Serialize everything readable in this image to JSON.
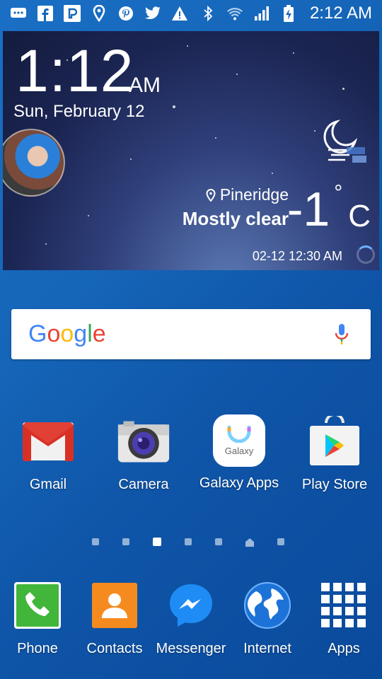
{
  "status_bar": {
    "time": "2:12 AM",
    "left_icons": [
      "messaging-icon",
      "facebook-icon",
      "p-app-icon",
      "location-pin-icon",
      "pinterest-icon",
      "twitter-icon",
      "warning-icon"
    ],
    "right_icons": [
      "bluetooth-icon",
      "wifi-icon",
      "signal-icon",
      "battery-charging-icon"
    ]
  },
  "widget": {
    "clock": "1:12",
    "ampm": "AM",
    "date": "Sun, February 12",
    "location": "Pineridge",
    "condition": "Mostly clear",
    "temp": "-1",
    "temp_unit": "C",
    "updated": "02-12 12:30 AM"
  },
  "search": {
    "logo": "Google"
  },
  "apps": [
    {
      "label": "Gmail"
    },
    {
      "label": "Camera"
    },
    {
      "label": "Galaxy Apps",
      "badge_text": "Galaxy"
    },
    {
      "label": "Play Store"
    }
  ],
  "pages": {
    "count": 7,
    "active": 3,
    "home": 6
  },
  "dock": [
    {
      "label": "Phone"
    },
    {
      "label": "Contacts"
    },
    {
      "label": "Messenger"
    },
    {
      "label": "Internet"
    },
    {
      "label": "Apps"
    }
  ]
}
